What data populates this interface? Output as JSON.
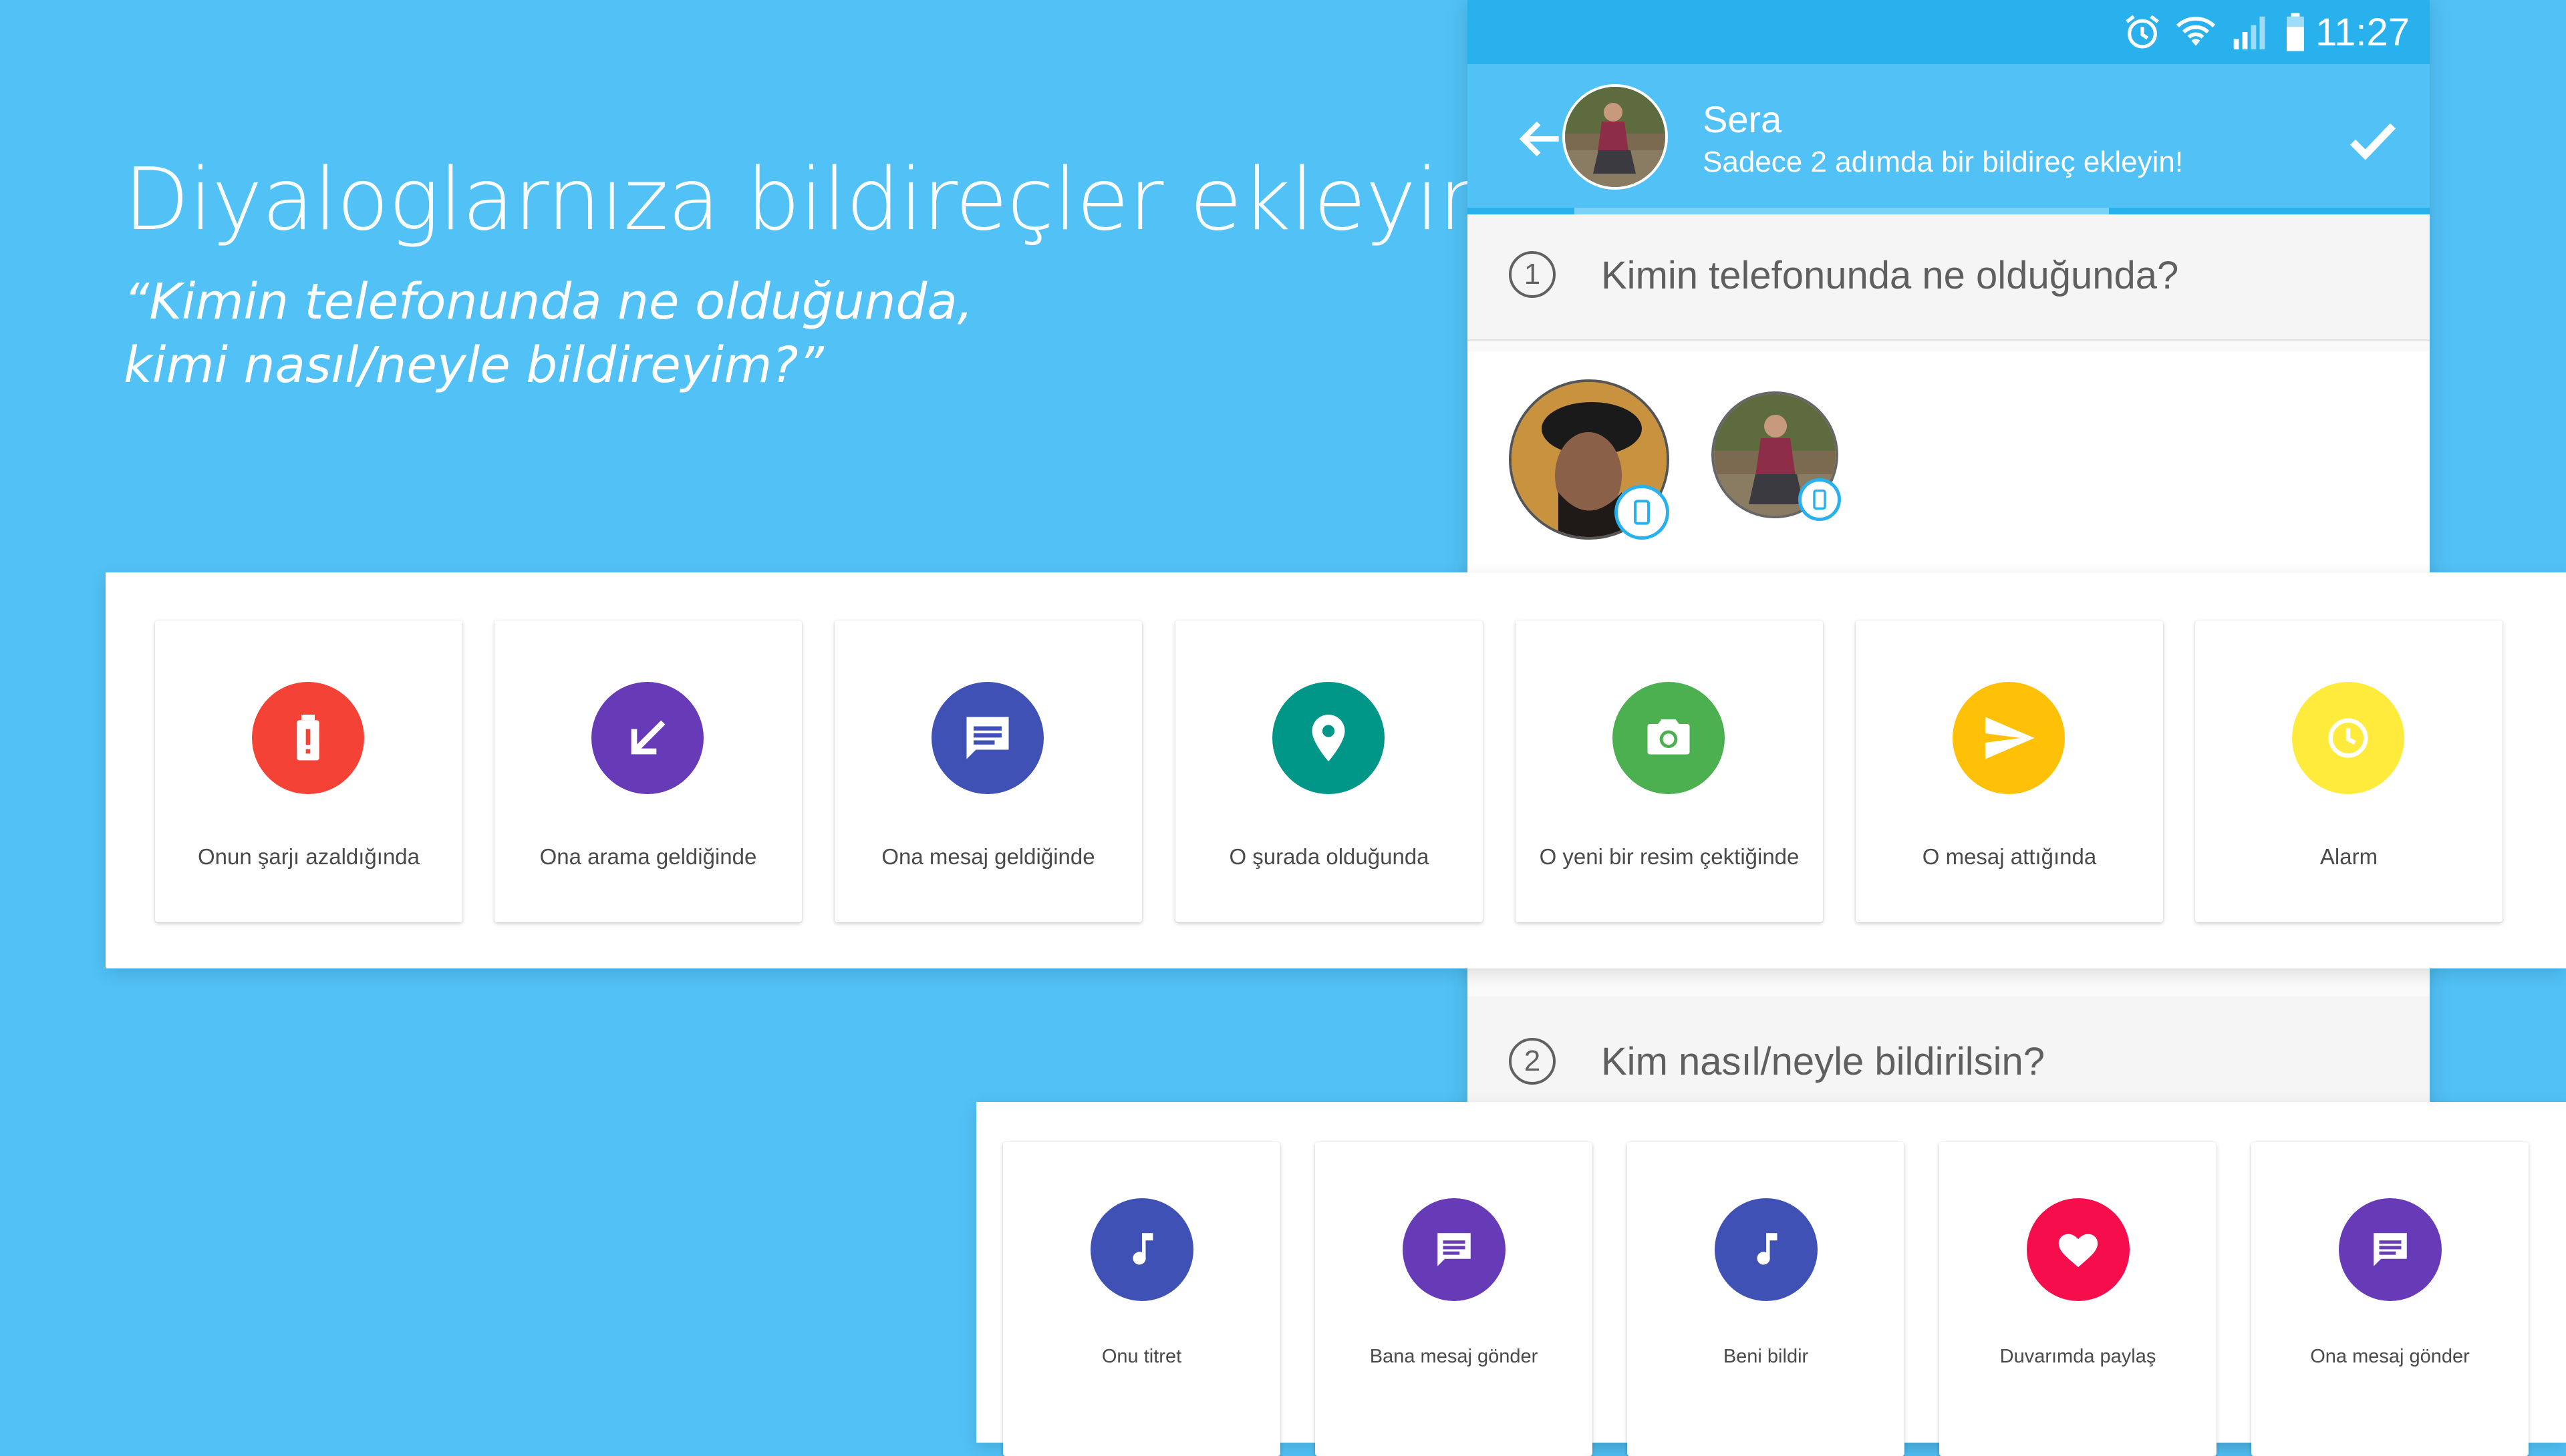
{
  "promo": {
    "title": "Diyaloglarnıza bildireçler ekleyin",
    "subtitle_line1": "“Kimin telefonunda ne olduğunda,",
    "subtitle_line2": "kimi nasıl/neyle bildireyim?”"
  },
  "statusbar": {
    "time": "11:27",
    "icons": [
      "alarm-clock-icon",
      "wifi-icon",
      "signal-icon",
      "battery-icon"
    ]
  },
  "toolbar": {
    "name": "Sera",
    "subtitle": "Sadece 2 adımda bir bildireç ekleyin!"
  },
  "steps": [
    {
      "number": "1",
      "text": "Kimin telefonunda ne olduğunda?"
    },
    {
      "number": "2",
      "text": "Kim nasıl/neyle bildirilsin?"
    }
  ],
  "triggers": [
    {
      "label": "Onun şarjı azaldığında",
      "icon": "battery-alert-icon",
      "color": "#F44336"
    },
    {
      "label": "Ona arama geldiğinde",
      "icon": "incoming-call-arrow-icon",
      "color": "#673AB7"
    },
    {
      "label": "Ona mesaj geldiğinde",
      "icon": "message-icon",
      "color": "#3F51B5"
    },
    {
      "label": "O şurada olduğunda",
      "icon": "location-pin-icon",
      "color": "#009688"
    },
    {
      "label": "O yeni bir resim çektiğinde",
      "icon": "camera-icon",
      "color": "#4CAF50"
    },
    {
      "label": "O mesaj attığında",
      "icon": "send-icon",
      "color": "#FFC107"
    },
    {
      "label": "Alarm",
      "icon": "clock-icon",
      "color": "#FFEB3B"
    }
  ],
  "actions": [
    {
      "label": "Onu titret",
      "icon": "music-note-icon",
      "color": "#3F51B5"
    },
    {
      "label": "Bana mesaj gönder",
      "icon": "message-icon",
      "color": "#673AB7"
    },
    {
      "label": "Beni bildir",
      "icon": "music-note-icon",
      "color": "#3F51B5"
    },
    {
      "label": "Duvarımda paylaş",
      "icon": "heart-icon",
      "color": "#F50D4C"
    },
    {
      "label": "Ona mesaj gönder",
      "icon": "message-icon",
      "color": "#673AB7"
    }
  ],
  "colors": {
    "background": "#51C1F6",
    "statusbar": "#29B1EE",
    "accent": "#29B1EE"
  }
}
